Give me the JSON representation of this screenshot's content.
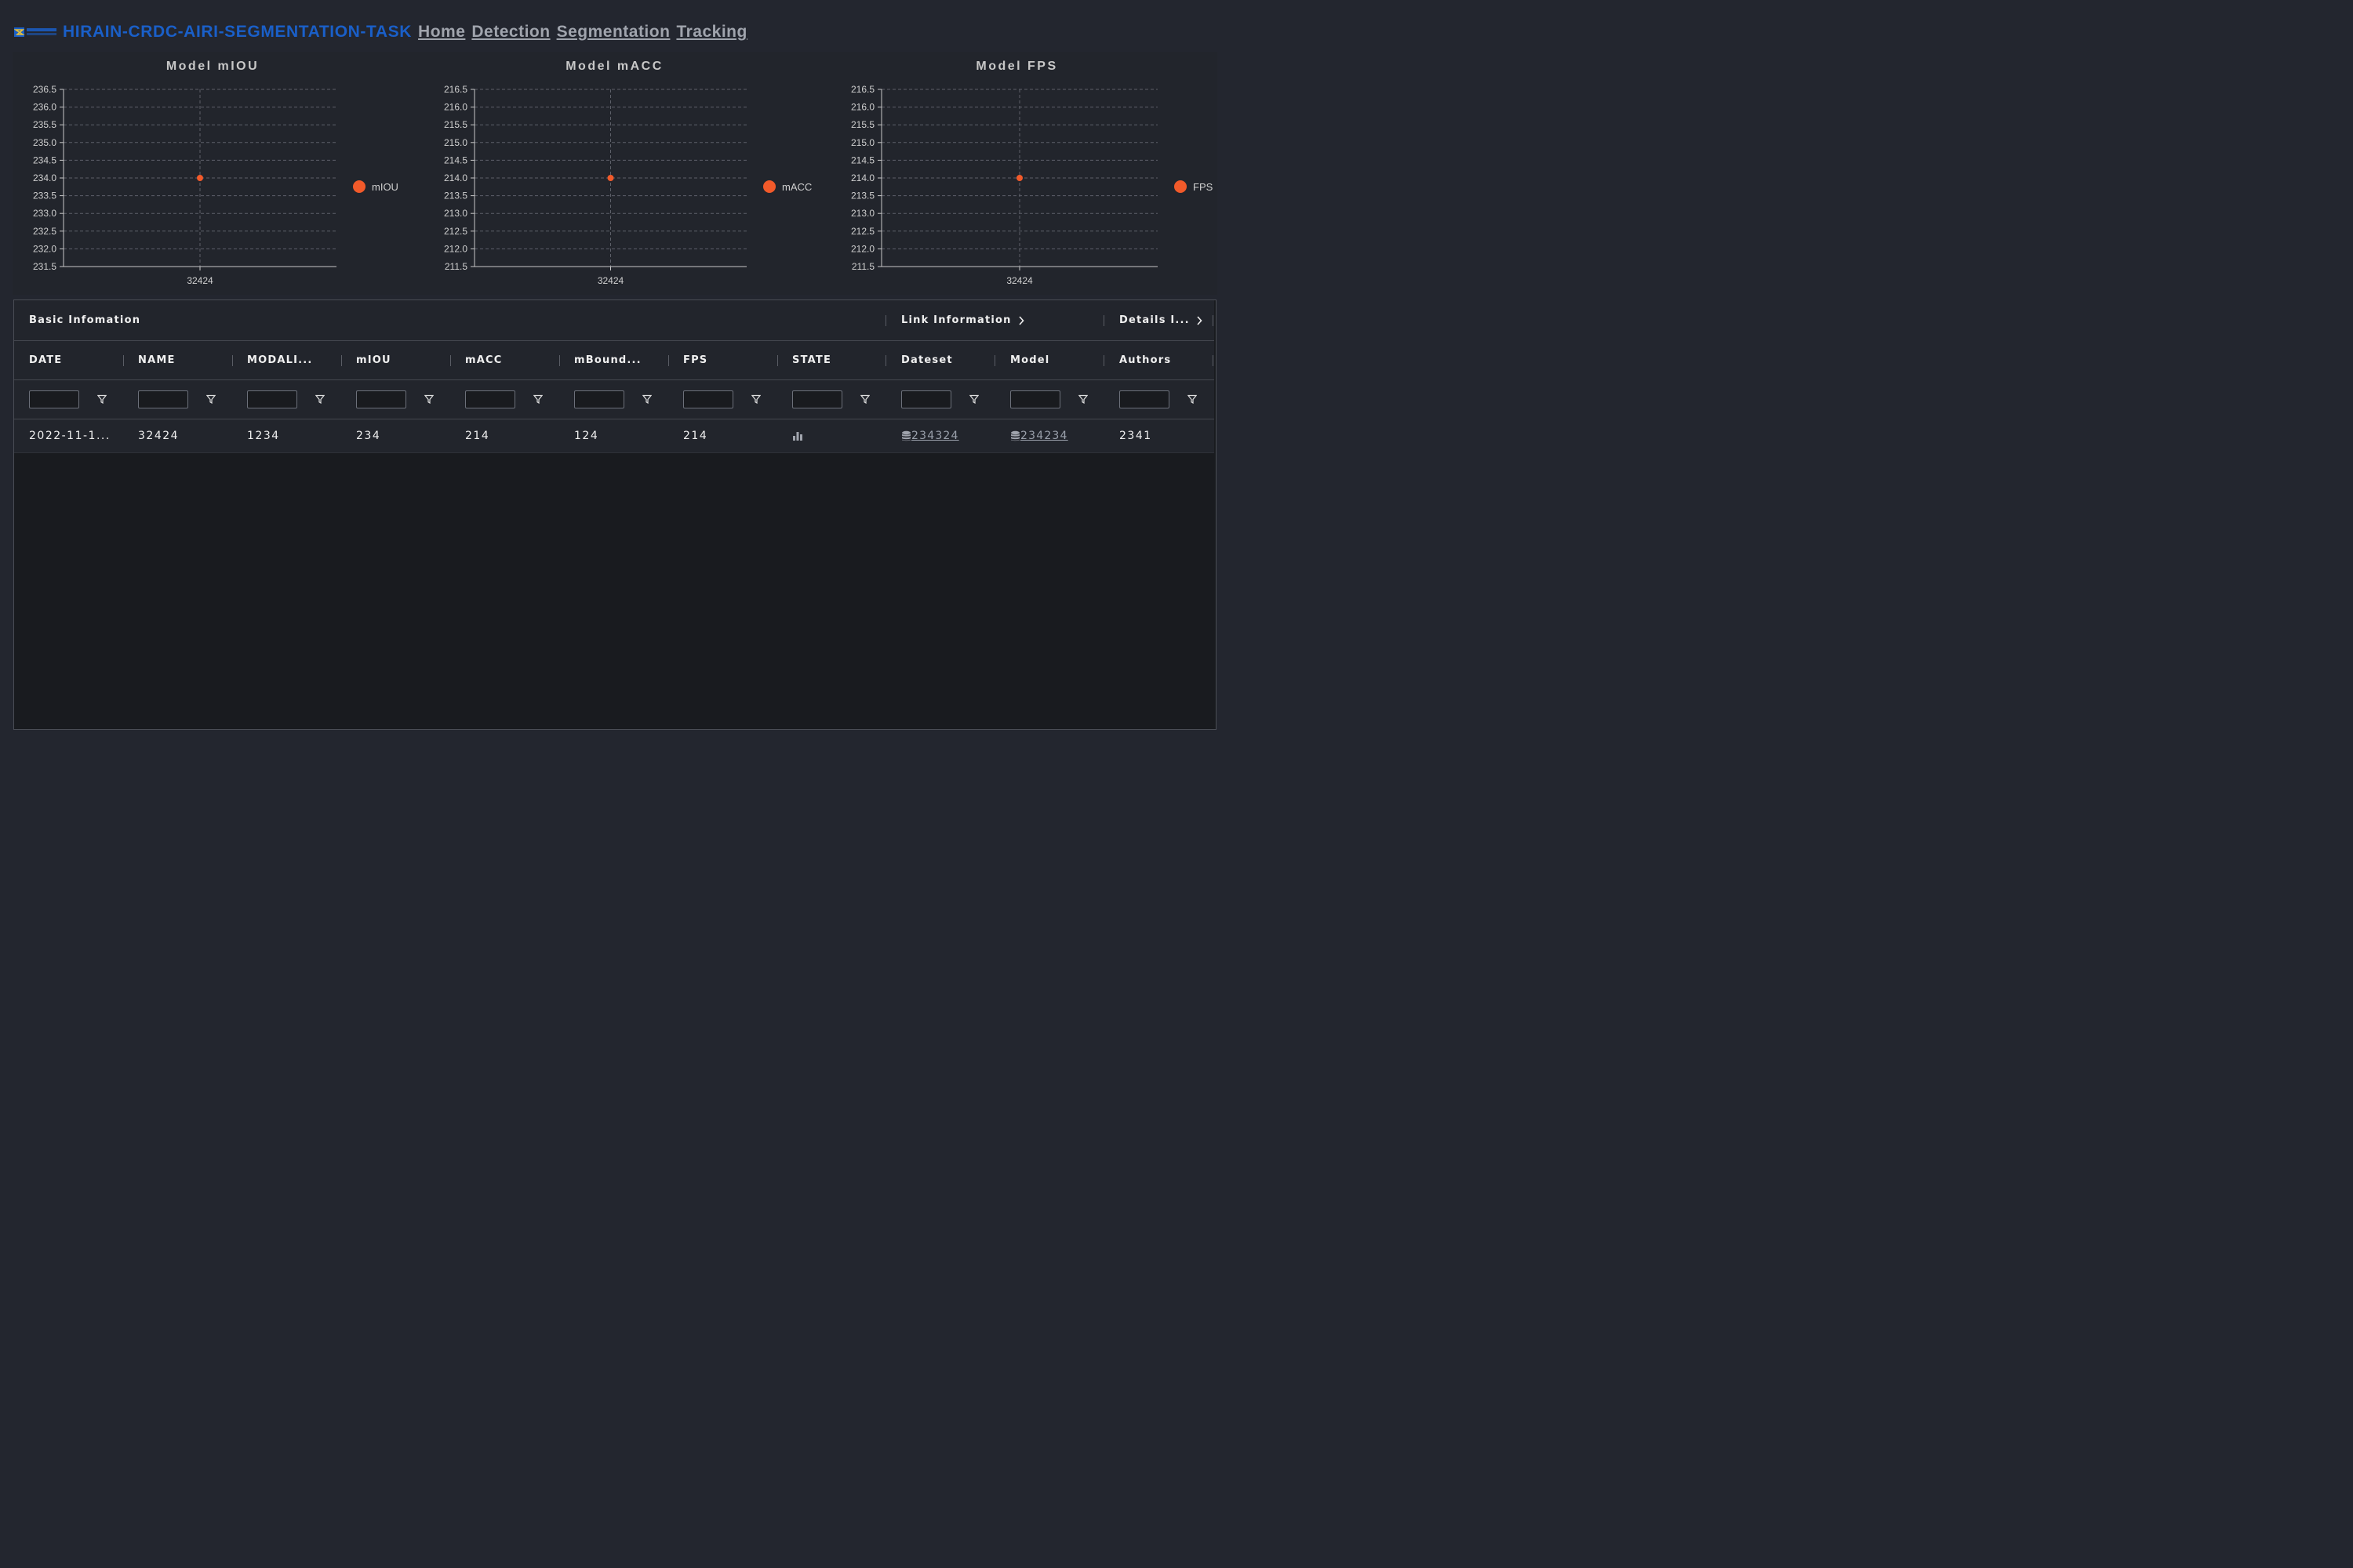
{
  "header": {
    "title": "HIRAIN-CRDC-AIRI-SEGMENTATION-TASK",
    "nav": [
      "Home",
      "Detection",
      "Segmentation",
      "Tracking"
    ]
  },
  "colors": {
    "background": "#23262f",
    "title": "#1a5fc8",
    "nav": "#a0a4ad",
    "point": "#f25a2a"
  },
  "chart_data": [
    {
      "type": "scatter",
      "title": "Model mIOU",
      "categories": [
        "32424"
      ],
      "series": [
        {
          "name": "mIOU",
          "values": [
            234
          ]
        }
      ],
      "yticks": [
        "236.5",
        "236.0",
        "235.5",
        "235.0",
        "234.5",
        "234.0",
        "233.5",
        "233.0",
        "232.5",
        "232.0",
        "231.5"
      ],
      "ylim": [
        231.5,
        236.5
      ],
      "grid": true,
      "legend": "right"
    },
    {
      "type": "scatter",
      "title": "Model mACC",
      "categories": [
        "32424"
      ],
      "series": [
        {
          "name": "mACC",
          "values": [
            214
          ]
        }
      ],
      "yticks": [
        "216.5",
        "216.0",
        "215.5",
        "215.0",
        "214.5",
        "214.0",
        "213.5",
        "213.0",
        "212.5",
        "212.0",
        "211.5"
      ],
      "ylim": [
        211.5,
        216.5
      ],
      "grid": true,
      "legend": "right"
    },
    {
      "type": "scatter",
      "title": "Model FPS",
      "categories": [
        "32424"
      ],
      "series": [
        {
          "name": "FPS",
          "values": [
            214
          ]
        }
      ],
      "yticks": [
        "216.5",
        "216.0",
        "215.5",
        "215.0",
        "214.5",
        "214.0",
        "213.5",
        "213.0",
        "212.5",
        "212.0",
        "211.5"
      ],
      "ylim": [
        211.5,
        216.5
      ],
      "grid": true,
      "legend": "right"
    }
  ],
  "table": {
    "groups": {
      "basic": "Basic Infomation",
      "link": "Link Information",
      "details": "Details I..."
    },
    "columns": [
      "DATE",
      "NAME",
      "MODALI...",
      "mIOU",
      "mACC",
      "mBound...",
      "FPS",
      "STATE",
      "Dateset",
      "Model",
      "Authors"
    ],
    "rows": [
      {
        "date": "2022-11-1...",
        "name": "32424",
        "modality": "1234",
        "miou": "234",
        "macc": "214",
        "mbound": "124",
        "fps": "214",
        "state_icon": "bar-chart-icon",
        "dataset": "234324",
        "model": "234234",
        "authors": "2341"
      }
    ]
  }
}
